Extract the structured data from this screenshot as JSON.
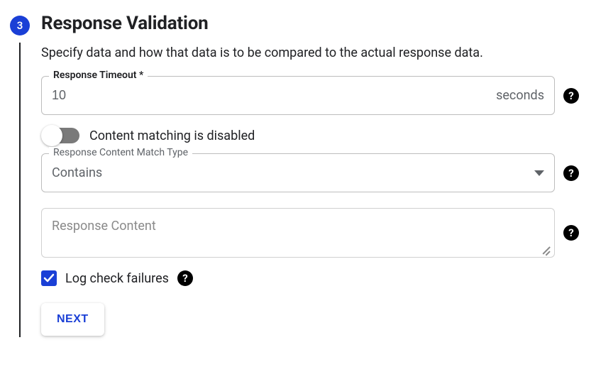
{
  "step": {
    "number": "3",
    "title": "Response Validation"
  },
  "description": "Specify data and how that data is to be compared to the actual response data.",
  "timeout": {
    "label": "Response Timeout *",
    "value": "10",
    "unit": "seconds"
  },
  "toggle": {
    "label": "Content matching is disabled",
    "on": false
  },
  "match_type": {
    "label": "Response Content Match Type",
    "value": "Contains"
  },
  "content": {
    "placeholder": "Response Content",
    "value": ""
  },
  "log_failures": {
    "label": "Log check failures",
    "checked": true
  },
  "next_label": "NEXT"
}
